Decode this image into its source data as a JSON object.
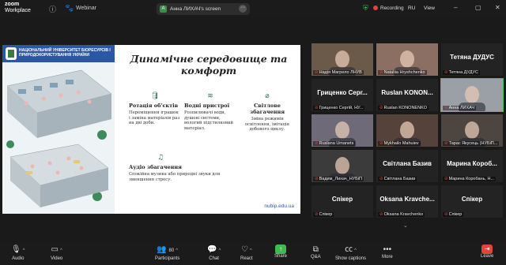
{
  "app": {
    "logo_line1": "zoom",
    "logo_line2": "Workplace",
    "meeting_type": "Webinar"
  },
  "screen_share": {
    "avatar_letter": "A",
    "label": "Анна ЛИХАЧ's screen"
  },
  "status": {
    "recording": "Recording",
    "language": "RU",
    "view": "View"
  },
  "slide": {
    "header": "НАЦІОНАЛЬНИЙ УНІВЕРСИТЕТ БІОРЕСУРСІВ І ПРИРОДОКОРИСТУВАННЯ УКРАЇНИ",
    "title": "Динамічне середовище та комфорт",
    "features": [
      {
        "heading": "Ротація об'єктів",
        "text": "Переміщення іграшок і заміна матеріалів раз на дві доби."
      },
      {
        "heading": "Водні пристрої",
        "text": "Розпилювачі води, душові системи, вологий підстилковий матеріал."
      },
      {
        "heading": "Світлове збагачення",
        "text": "Зміна режимів освітлення, імітація добового циклу."
      },
      {
        "heading": "Аудіо збагачення",
        "text": "Спокійна музика або природні звуки для зменшення стресу."
      }
    ],
    "footer": "nubip.edu.ua"
  },
  "participants": [
    {
      "name": "Надія Магрело ЛНУВ",
      "kind": "video",
      "color": "#6b5a4a"
    },
    {
      "name": "Nataliia Hryshchenko",
      "kind": "video",
      "color": "#8c6f63"
    },
    {
      "name": "Тетяна ДУДУС",
      "big": "Тетяна ДУДУС",
      "kind": "name",
      "color": "#232323"
    },
    {
      "name": "Гриценко Сергій, НУ...",
      "big": "Гриценко Серг...",
      "kind": "name",
      "color": "#232323"
    },
    {
      "name": "Ruslan KONONENKO",
      "big": "Ruslan KONON...",
      "kind": "name",
      "color": "#232323"
    },
    {
      "name": "Анна ЛИХАЧ",
      "kind": "video",
      "color": "#9aa0a6",
      "active": true
    },
    {
      "name": "Ruslana Umanets",
      "kind": "video",
      "color": "#6e6a78"
    },
    {
      "name": "Mykhailo Mahuiev",
      "kind": "video",
      "color": "#55433b"
    },
    {
      "name": "Тарас Якусець (НУБіП...",
      "kind": "video",
      "color": "#4d4540"
    },
    {
      "name": "Вадим_Лихач_НУБіП",
      "kind": "video",
      "color": "#3b3b3b"
    },
    {
      "name": "Світлана Базив",
      "big": "Світлана Базив",
      "kind": "name",
      "color": "#232323"
    },
    {
      "name": "Марина Коробань, Н...",
      "big": "Марина Короб...",
      "kind": "name",
      "color": "#232323"
    },
    {
      "name": "Спікер",
      "big": "Спікер",
      "kind": "name",
      "color": "#232323"
    },
    {
      "name": "Oksana Kravchenko",
      "big": "Oksana Kravche...",
      "kind": "name",
      "color": "#232323"
    },
    {
      "name": "Спікер",
      "big": "Спікер",
      "kind": "name",
      "color": "#232323"
    }
  ],
  "toolbar": {
    "audio": "Audio",
    "video": "Video",
    "participants": "Participants",
    "participants_count": "80",
    "chat": "Chat",
    "react": "React",
    "share": "Share",
    "qa": "Q&A",
    "captions": "Show captions",
    "more": "More",
    "leave": "Leave"
  }
}
